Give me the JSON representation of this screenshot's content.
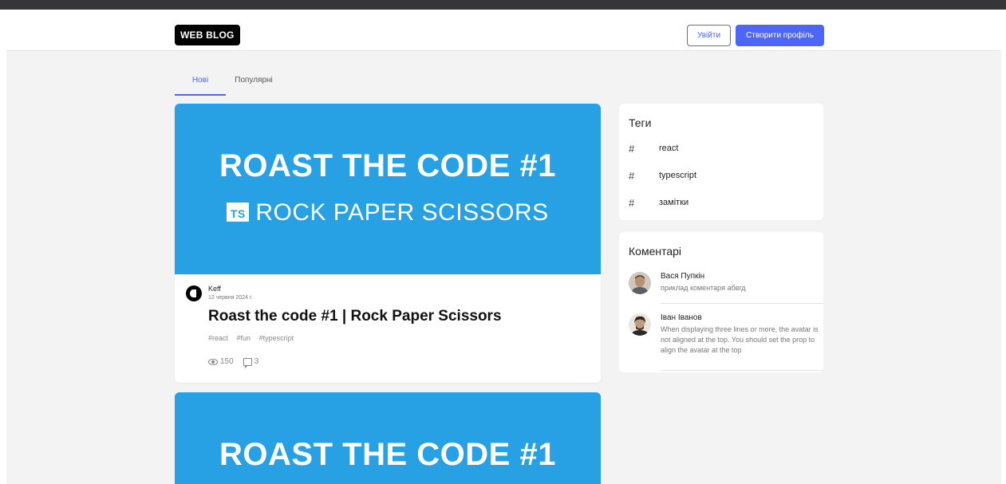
{
  "header": {
    "logo": "WEB BLOG",
    "login_label": "Увійти",
    "register_label": "Створити профіль"
  },
  "tabs": [
    {
      "label": "Нові",
      "active": true
    },
    {
      "label": "Популярні",
      "active": false
    }
  ],
  "posts": [
    {
      "cover_title": "ROAST THE CODE #1",
      "cover_badge": "TS",
      "cover_subtitle": "ROCK PAPER SCISSORS",
      "author": "Keff",
      "date": "12 червня 2024 г.",
      "title": "Roast the code #1 | Rock Paper Scissors",
      "tags": [
        "#react",
        "#fun",
        "#typescript"
      ],
      "views": "150",
      "comments": "3"
    },
    {
      "cover_title": "ROAST THE CODE #1"
    }
  ],
  "sidebar": {
    "tags_heading": "Теги",
    "tags": [
      "react",
      "typescript",
      "замітки"
    ],
    "comments_heading": "Коментарі",
    "comments": [
      {
        "name": "Вася Пупкін",
        "text": "приклад коментаря абвгд"
      },
      {
        "name": "Іван Іванов",
        "text": "When displaying three lines or more, the avatar is not aligned at the top. You should set the prop to align the avatar at the top"
      }
    ]
  },
  "colors": {
    "accent": "#4e66f8",
    "cover": "#28a0e4"
  }
}
